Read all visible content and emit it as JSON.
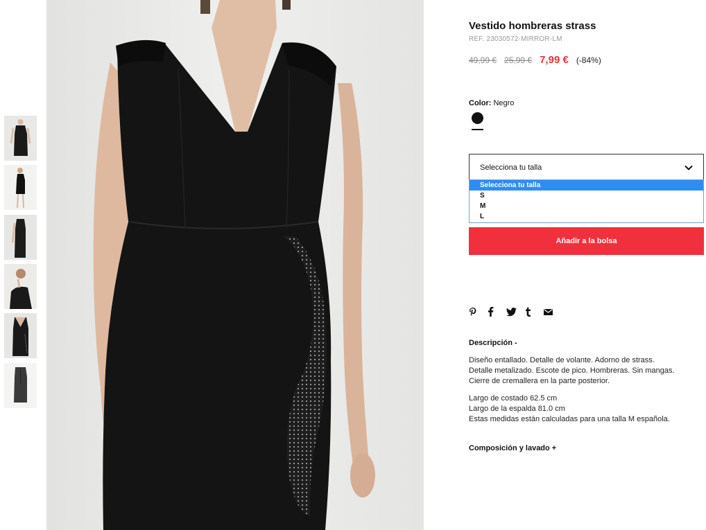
{
  "product": {
    "title": "Vestido hombreras strass",
    "ref": "REF. 23030572-MIRROR-LM",
    "old_price_1": "49,99 €",
    "old_price_2": "25,99 €",
    "sale_price": "7,99 €",
    "discount": "(-84%)"
  },
  "color": {
    "label": "Color:",
    "value": "Negro",
    "swatch_hex": "#111111"
  },
  "size_select": {
    "selected": "Selecciona tu talla",
    "options": [
      "Selecciona tu talla",
      "S",
      "M",
      "L"
    ]
  },
  "add_to_bag": "Añadir a la bolsa",
  "share_icons": [
    "pinterest-icon",
    "facebook-icon",
    "twitter-icon",
    "tumblr-icon",
    "email-icon"
  ],
  "description": {
    "heading": "Descripción  -",
    "lines_1": [
      "Diseño entallado. Detalle de volante. Adorno de strass.",
      "Detalle metalizado. Escote de pico. Hombreras. Sin mangas.",
      "Cierre de cremallera en la parte posterior."
    ],
    "lines_2": [
      "Largo de costado 62.5 cm",
      "Largo de la espalda 81.0 cm",
      "Estas medidas están calculadas para una talla M española."
    ]
  },
  "composition_heading": "Composición y lavado  +",
  "thumbnails": [
    "thumb-front",
    "thumb-full",
    "thumb-side",
    "thumb-profile",
    "thumb-detail",
    "thumb-back"
  ],
  "colors": {
    "accent_red": "#f0303d",
    "sale_red": "#e8303b",
    "select_blue": "#2f8cf5"
  }
}
